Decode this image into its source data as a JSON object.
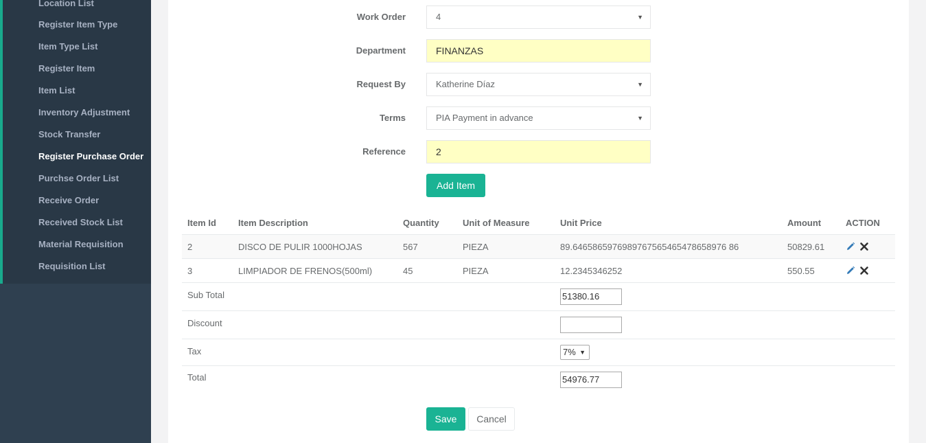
{
  "sidebar": {
    "items": [
      {
        "label": "Location List"
      },
      {
        "label": "Register Item Type"
      },
      {
        "label": "Item Type List"
      },
      {
        "label": "Register Item"
      },
      {
        "label": "Item List"
      },
      {
        "label": "Inventory Adjustment"
      },
      {
        "label": "Stock Transfer"
      },
      {
        "label": "Register Purchase Order"
      },
      {
        "label": "Purchse Order List"
      },
      {
        "label": "Receive Order"
      },
      {
        "label": "Received Stock List"
      },
      {
        "label": "Material Requisition"
      },
      {
        "label": "Requisition List"
      }
    ],
    "active_item": "Register Purchase Order"
  },
  "form": {
    "work_order": {
      "label": "Work Order",
      "value": "4"
    },
    "department": {
      "label": "Department",
      "value": "FINANZAS"
    },
    "request_by": {
      "label": "Request By",
      "value": "Katherine Díaz"
    },
    "terms": {
      "label": "Terms",
      "value": "PIA Payment in advance"
    },
    "reference": {
      "label": "Reference",
      "value": "2"
    },
    "add_item_label": "Add Item"
  },
  "table": {
    "headers": [
      "Item Id",
      "Item Description",
      "Quantity",
      "Unit of Measure",
      "Unit Price",
      "Amount",
      "ACTION"
    ],
    "rows": [
      {
        "id": "2",
        "description": "DISCO DE PULIR 1000HOJAS",
        "quantity": "567",
        "uom": "PIEZA",
        "unit_price": "89.6465865976989767565465478658976 86",
        "amount": "50829.61"
      },
      {
        "id": "3",
        "description": "LIMPIADOR DE FRENOS(500ml)",
        "quantity": "45",
        "uom": "PIEZA",
        "unit_price": "12.2345346252",
        "amount": "550.55"
      }
    ]
  },
  "totals": {
    "sub_total": {
      "label": "Sub Total",
      "value": "51380.16"
    },
    "discount": {
      "label": "Discount",
      "value": ""
    },
    "tax": {
      "label": "Tax",
      "value": "7%"
    },
    "total": {
      "label": "Total",
      "value": "54976.77"
    }
  },
  "actions": {
    "save_label": "Save",
    "cancel_label": "Cancel"
  },
  "colors": {
    "sidebar_bg": "#2f4050",
    "accent": "#1ab394",
    "highlight_field": "#ffffc4",
    "edit_icon": "#337ab7"
  },
  "icons": {
    "edit": "pencil-icon",
    "delete": "times-icon",
    "dropdown": "caret-down-icon"
  }
}
